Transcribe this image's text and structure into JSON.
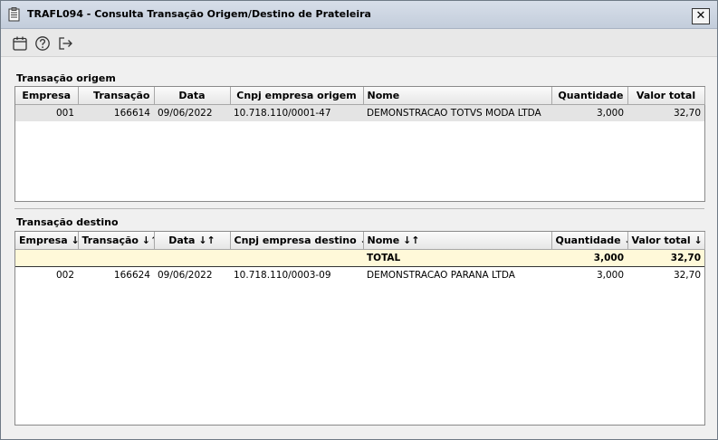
{
  "window": {
    "title": "TRAFL094 - Consulta Transação Origem/Destino de Prateleira",
    "close_label": "✕"
  },
  "toolbar": {
    "buttons": [
      {
        "icon": "calendar-icon"
      },
      {
        "icon": "help-icon"
      },
      {
        "icon": "exit-icon"
      }
    ]
  },
  "origem": {
    "label": "Transação origem",
    "columns": [
      "Empresa",
      "Transação",
      "Data",
      "Cnpj empresa origem",
      "Nome",
      "Quantidade",
      "Valor total"
    ],
    "rows": [
      [
        "001",
        "166614",
        "09/06/2022",
        "10.718.110/0001-47",
        "DEMONSTRACAO TOTVS MODA LTDA",
        "3,000",
        "32,70"
      ]
    ]
  },
  "destino": {
    "label": "Transação destino",
    "columns": [
      "Empresa ↓↑",
      "Transação ↓↑",
      "Data ↓↑",
      "Cnpj empresa destino ↓↑",
      "Nome ↓↑",
      "Quantidade ↓↑",
      "Valor total ↓↑"
    ],
    "total": [
      "",
      "",
      "",
      "",
      "TOTAL",
      "3,000",
      "32,70"
    ],
    "rows": [
      [
        "002",
        "166624",
        "09/06/2022",
        "10.718.110/0003-09",
        "DEMONSTRACAO PARANA LTDA",
        "3,000",
        "32,70"
      ]
    ]
  }
}
